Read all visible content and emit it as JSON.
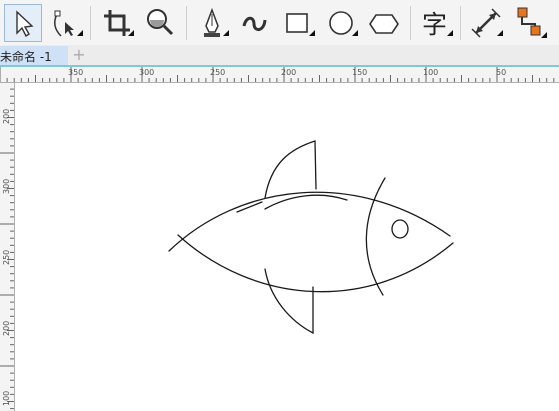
{
  "toolbar": {
    "tools": [
      {
        "name": "pick-tool",
        "icon": "arrow-pointer-icon",
        "selected": true
      },
      {
        "name": "shape-tool",
        "icon": "node-edit-icon"
      },
      {
        "name": "crop-tool",
        "icon": "crop-icon"
      },
      {
        "name": "zoom-tool",
        "icon": "magnifier-icon"
      },
      {
        "name": "pen-tool",
        "icon": "pen-nib-icon"
      },
      {
        "name": "artistic-media-tool",
        "icon": "squiggle-icon"
      },
      {
        "name": "rectangle-tool",
        "icon": "rectangle-icon"
      },
      {
        "name": "ellipse-tool",
        "icon": "ellipse-icon"
      },
      {
        "name": "polygon-tool",
        "icon": "hexagon-icon"
      },
      {
        "name": "text-tool",
        "icon": "text-glyph-icon",
        "glyph": "字"
      },
      {
        "name": "dimension-tool",
        "icon": "dimension-arrow-icon"
      },
      {
        "name": "connector-tool",
        "icon": "connector-icon"
      }
    ]
  },
  "tabs": {
    "document_title": "未命名 -1",
    "add_label": "+"
  },
  "ruler": {
    "top_labels": [
      "350",
      "300",
      "250",
      "200",
      "150",
      "100",
      "50"
    ],
    "left_labels": [
      "200",
      "300",
      "250",
      "200",
      "100"
    ]
  },
  "colors": {
    "accent": "#7fc8d8",
    "tab_active": "#cfe1f6",
    "icon_orange": "#e8741c",
    "stroke": "#1a1a1a"
  }
}
